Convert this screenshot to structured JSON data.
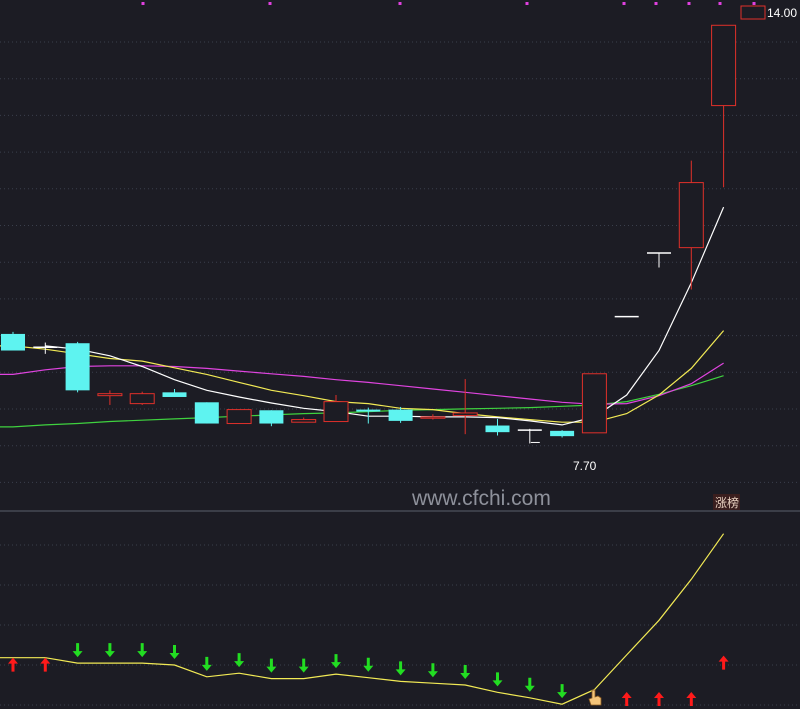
{
  "watermark": "www.cfchi.com",
  "badge": "涨榜",
  "colors": {
    "background": "#1c1c24",
    "grid": "#3a3f4c",
    "up": "#e0302a",
    "down": "#5ef3f0",
    "ma5": "#ffffff",
    "ma10": "#f2ea55",
    "ma20": "#e044e0",
    "ma60": "#3fd23f",
    "indicator_line": "#f2ea55",
    "arrow_up": "#ff1a1a",
    "arrow_down": "#22dd22",
    "marker": "#e040e0"
  },
  "chart_data": [
    {
      "type": "candlestick",
      "high_label": "14.00",
      "low_label": "7.70",
      "ylim": [
        7.3,
        14.2
      ],
      "top_markers": [
        1,
        4,
        7,
        8,
        10,
        11
      ],
      "candles": [
        {
          "o": 9.35,
          "h": 9.38,
          "l": 9.1,
          "c": 9.1
        },
        {
          "o": 9.15,
          "h": 9.22,
          "l": 9.05,
          "c": 9.15
        },
        {
          "o": 9.21,
          "h": 9.23,
          "l": 8.47,
          "c": 8.5
        },
        {
          "o": 8.42,
          "h": 8.5,
          "l": 8.28,
          "c": 8.45
        },
        {
          "o": 8.3,
          "h": 8.48,
          "l": 8.28,
          "c": 8.45
        },
        {
          "o": 8.47,
          "h": 8.52,
          "l": 8.4,
          "c": 8.4
        },
        {
          "o": 8.32,
          "h": 8.32,
          "l": 8.0,
          "c": 8.0
        },
        {
          "o": 8.0,
          "h": 8.21,
          "l": 8.0,
          "c": 8.21
        },
        {
          "o": 8.2,
          "h": 8.2,
          "l": 7.96,
          "c": 8.0
        },
        {
          "o": 8.02,
          "h": 8.09,
          "l": 8.02,
          "c": 8.06
        },
        {
          "o": 8.03,
          "h": 8.43,
          "l": 8.03,
          "c": 8.33
        },
        {
          "o": 8.21,
          "h": 8.24,
          "l": 8.0,
          "c": 8.18
        },
        {
          "o": 8.21,
          "h": 8.25,
          "l": 8.01,
          "c": 8.04
        },
        {
          "o": 8.08,
          "h": 8.14,
          "l": 8.06,
          "c": 8.1
        },
        {
          "o": 8.12,
          "h": 8.67,
          "l": 7.84,
          "c": 8.16
        },
        {
          "o": 7.97,
          "h": 8.07,
          "l": 7.82,
          "c": 7.87
        },
        {
          "o": 7.9,
          "h": 7.92,
          "l": 7.7,
          "c": 7.9
        },
        {
          "o": 7.89,
          "h": 7.9,
          "l": 7.79,
          "c": 7.81
        },
        {
          "o": 7.86,
          "h": 8.75,
          "l": 7.86,
          "c": 8.75
        },
        {
          "o": 9.61,
          "h": 9.61,
          "l": 9.61,
          "c": 9.61
        },
        {
          "o": 10.57,
          "h": 10.57,
          "l": 10.35,
          "c": 10.57
        },
        {
          "o": 10.65,
          "h": 11.96,
          "l": 10.02,
          "c": 11.63
        },
        {
          "o": 12.79,
          "h": 14.0,
          "l": 11.56,
          "c": 14.0
        }
      ],
      "ma5": [
        null,
        9.17,
        9.12,
        9.02,
        8.86,
        8.66,
        8.5,
        8.4,
        8.31,
        8.23,
        8.18,
        8.11,
        8.11,
        8.1,
        8.1,
        8.09,
        8.04,
        7.98,
        8.1,
        8.43,
        9.1,
        10.12,
        11.26
      ],
      "ma10": [
        9.17,
        9.12,
        9.05,
        8.98,
        8.94,
        8.84,
        8.74,
        8.62,
        8.5,
        8.42,
        8.33,
        8.3,
        8.23,
        8.21,
        8.15,
        8.1,
        8.06,
        8.02,
        8.02,
        8.15,
        8.43,
        8.83,
        9.4
      ],
      "ma20": [
        8.74,
        8.81,
        8.86,
        8.87,
        8.87,
        8.86,
        8.83,
        8.79,
        8.75,
        8.71,
        8.66,
        8.62,
        8.57,
        8.52,
        8.47,
        8.42,
        8.37,
        8.32,
        8.29,
        8.3,
        8.42,
        8.6,
        8.91
      ],
      "ma60": [
        7.95,
        7.98,
        8.0,
        8.03,
        8.05,
        8.07,
        8.09,
        8.11,
        8.13,
        8.15,
        8.16,
        8.18,
        8.2,
        8.21,
        8.22,
        8.23,
        8.24,
        8.26,
        8.28,
        8.33,
        8.44,
        8.57,
        8.72
      ]
    },
    {
      "type": "line",
      "line": [
        8.9,
        8.9,
        8.3,
        8.3,
        8.3,
        8.1,
        6.8,
        7.2,
        6.6,
        6.6,
        7.1,
        6.7,
        6.3,
        6.1,
        5.9,
        5.1,
        4.5,
        3.8,
        5.4,
        9.2,
        13.0,
        17.5,
        22.5
      ],
      "ylim": [
        3.6,
        24
      ],
      "arrows": [
        "up",
        "up",
        "down",
        "down",
        "down",
        "down",
        "down",
        "down",
        "down",
        "down",
        "down",
        "down",
        "down",
        "down",
        "down",
        "down",
        "down",
        "down",
        "none",
        "up",
        "up",
        "up",
        "up"
      ]
    }
  ]
}
